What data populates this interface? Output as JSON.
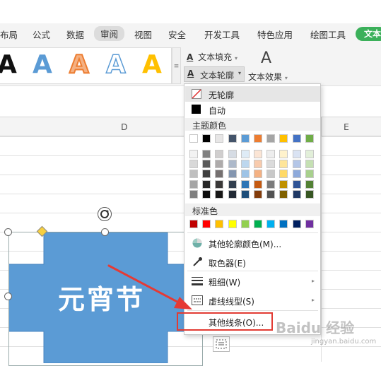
{
  "menubar": {
    "items": [
      "布局",
      "公式",
      "数据",
      "审阅",
      "视图",
      "安全",
      "开发工具",
      "特色应用",
      "绘图工具"
    ],
    "active": "审阅",
    "text_tab": "文本"
  },
  "ribbon": {
    "gallery_letters": [
      "A",
      "A",
      "A",
      "A",
      "A"
    ],
    "text_fill": "文本填充",
    "text_outline": "文本轮廓",
    "text_effect": "文本效果",
    "effect_letter": "A"
  },
  "columns": {
    "d": "D",
    "e": "E"
  },
  "shape": {
    "text": "元宵节",
    "fill_color": "#5b9bd5"
  },
  "dropdown": {
    "no_outline": "无轮廓",
    "auto": "自动",
    "theme_colors_title": "主题颜色",
    "theme_top_row": [
      "#ffffff",
      "#000000",
      "#e7e6e6",
      "#44546a",
      "#5b9bd5",
      "#ed7d31",
      "#a5a5a5",
      "#ffc000",
      "#4472c4",
      "#70ad47"
    ],
    "theme_shades": [
      [
        "#f2f2f2",
        "#7f7f7f",
        "#d0cece",
        "#d6dce4",
        "#deebf6",
        "#fbe5d5",
        "#ededed",
        "#fff2cc",
        "#dae3f3",
        "#e2efd9"
      ],
      [
        "#d8d8d8",
        "#595959",
        "#aeabab",
        "#adb9ca",
        "#bdd7ee",
        "#f8cbad",
        "#dbdbdb",
        "#fee599",
        "#b4c6e7",
        "#c5e0b3"
      ],
      [
        "#bfbfbf",
        "#3f3f3f",
        "#757070",
        "#8496b0",
        "#9dc3e6",
        "#f4b183",
        "#c9c9c9",
        "#ffd965",
        "#8eaadb",
        "#a8d08d"
      ],
      [
        "#a5a5a5",
        "#262626",
        "#3a3838",
        "#323f4f",
        "#2e75b5",
        "#c55a11",
        "#7b7b7b",
        "#bf9000",
        "#2f5496",
        "#538135"
      ],
      [
        "#7f7f7f",
        "#0c0c0c",
        "#171616",
        "#222a35",
        "#1e4e79",
        "#833c0b",
        "#525252",
        "#7f6000",
        "#1f3864",
        "#375623"
      ]
    ],
    "standard_colors_title": "标准色",
    "standard_colors": [
      "#c00000",
      "#ff0000",
      "#ffc000",
      "#ffff00",
      "#92d050",
      "#00b050",
      "#00b0f0",
      "#0070c0",
      "#002060",
      "#7030a0"
    ],
    "more_colors": "其他轮廓颜色(M)...",
    "eyedropper": "取色器(E)",
    "weight": "粗细(W)",
    "dash": "虚线线型(S)",
    "other_lines": "其他线条(O)..."
  },
  "watermark": {
    "text": "Baidu 经验",
    "sub": "jingyan.baidu.com"
  }
}
